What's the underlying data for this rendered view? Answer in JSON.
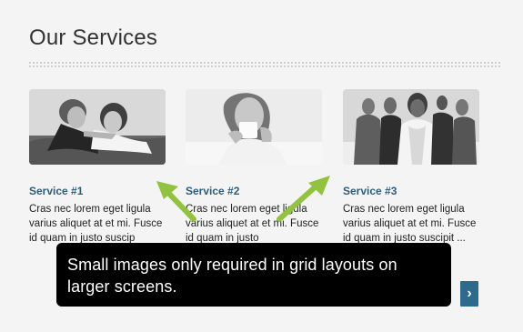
{
  "header": {
    "title": "Our Services"
  },
  "services": [
    {
      "title": "Service #1",
      "text": "Cras nec lorem eget ligula varius aliquet at et mi. Fusce id quam in justo suscip",
      "image_name": "couple-lying-on-grass-image"
    },
    {
      "title": "Service #2",
      "text": "Cras nec lorem eget ligula varius aliquet at et mi. Fusce id quam in justo",
      "image_name": "woman-with-mug-image"
    },
    {
      "title": "Service #3",
      "text": "Cras nec lorem eget ligula varius aliquet at et mi. Fusce id quam in justo suscipit ...",
      "image_name": "business-team-image"
    }
  ],
  "tooltip": {
    "text": "Small images only required in grid layouts on larger screens."
  },
  "controls": {
    "next_symbol": "›"
  },
  "colors": {
    "accent": "#2d5d7b",
    "arrow": "#92c33f",
    "button": "#2d6a8b",
    "tooltip": "#000000"
  }
}
